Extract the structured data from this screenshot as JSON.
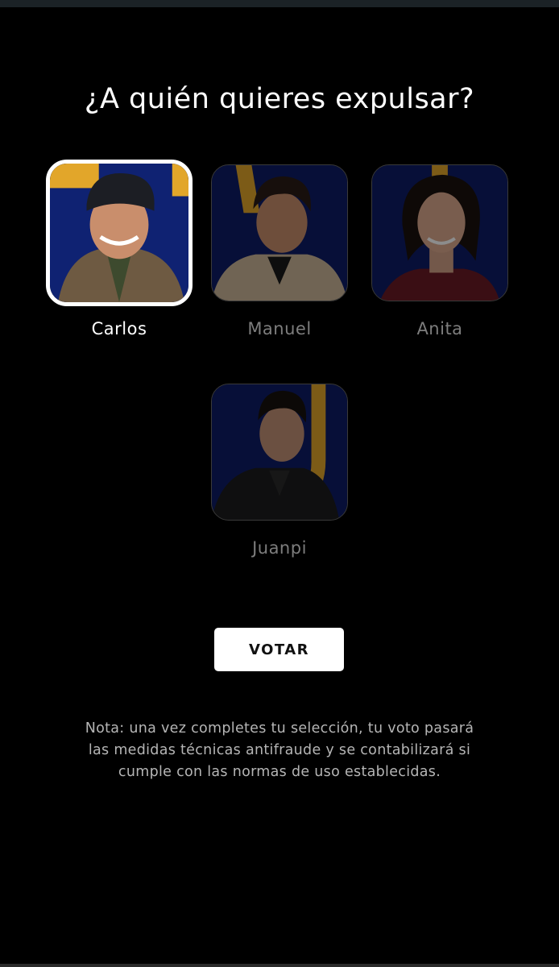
{
  "page": {
    "title": "¿A quién quieres expulsar?",
    "vote_label": "VOTAR",
    "note": "Nota: una vez completes tu selección, tu voto pasará las medidas técnicas antifraude y se contabilizará si cumple con las normas de uso establecidas."
  },
  "candidates": [
    {
      "name": "Carlos",
      "selected": true
    },
    {
      "name": "Manuel",
      "selected": false
    },
    {
      "name": "Anita",
      "selected": false
    },
    {
      "name": "Juanpi",
      "selected": false
    }
  ],
  "colors": {
    "background": "#000000",
    "card_bg": "#0e1d66",
    "accent_yellow": "#e2a62a",
    "selected_border": "#ffffff",
    "dim_text": "#7d7d7d",
    "note_text": "#b5b5b5",
    "button_bg": "#ffffff"
  }
}
